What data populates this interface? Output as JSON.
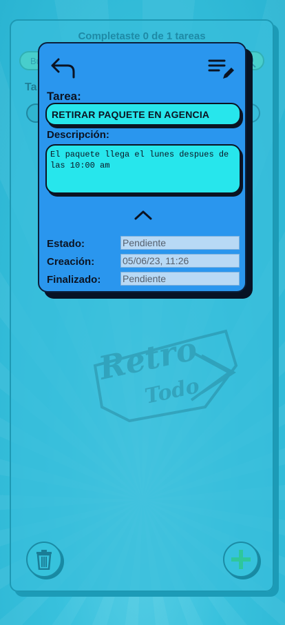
{
  "background": {
    "header_text": "Completaste 0 de 1 tareas",
    "search_placeholder": "Bu",
    "section_label": "Ta",
    "watermark_text_1": "Retro",
    "watermark_text_2": "Todo"
  },
  "modal": {
    "back_icon": "undo-arrow-icon",
    "edit_icon": "edit-list-icon",
    "title_label": "Tarea:",
    "title_value": "RETIRAR PAQUETE EN AGENCIA",
    "description_label": "Descripción:",
    "description_value": "El paquete llega el lunes despues de las 10:00 am",
    "collapse_icon": "chevron-up-icon",
    "info": [
      {
        "label": "Estado:",
        "value": "Pendiente"
      },
      {
        "label": "Creación:",
        "value": "05/06/23, 11:26"
      },
      {
        "label": "Finalizado:",
        "value": "Pendiente"
      }
    ]
  },
  "actions": {
    "delete_icon": "trash-icon",
    "add_icon": "plus-icon"
  },
  "colors": {
    "accent": "#2a96ee",
    "field": "#27e6ec",
    "background": "#38c1dd",
    "dark": "#0b1322"
  }
}
